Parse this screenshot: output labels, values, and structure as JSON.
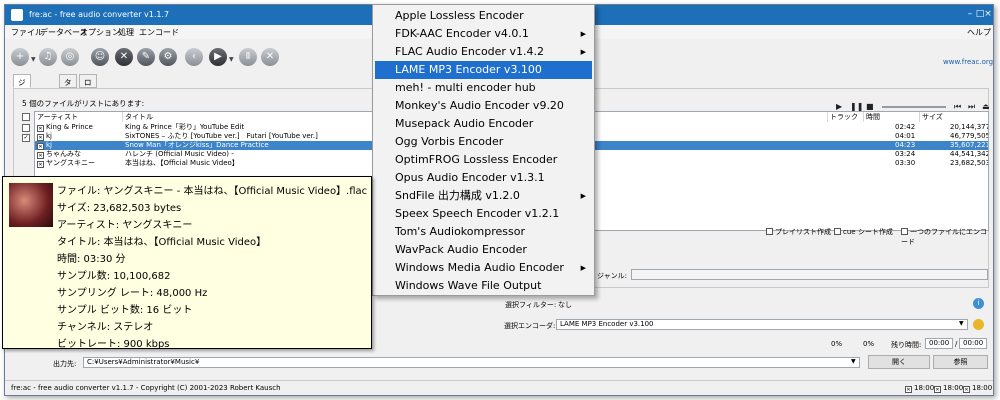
{
  "window": {
    "title": "fre:ac - free audio converter v1.1.7",
    "help": "ヘルプ",
    "website": "www.freac.org"
  },
  "menu": [
    "ファイル",
    "データベース",
    "オプション",
    "処理",
    "エンコード"
  ],
  "tabs": [
    "ジョブリスト",
    "タグ",
    "ログ"
  ],
  "list": {
    "count_text": "5 個のファイルがリストにあります:",
    "headers": [
      "アーティスト",
      "タイトル",
      "トラック",
      "時間",
      "サイズ"
    ],
    "rows": [
      {
        "artist": "King & Prince",
        "title": "King & Prince「彩り」YouTube Edit",
        "time": "02:42",
        "size": "20,144,377"
      },
      {
        "artist": "kj",
        "title": "SixTONES – ふたり [YouTube ver.]　Futari [YouTube ver.]",
        "time": "04:01",
        "size": "46,779,505"
      },
      {
        "artist": "kj",
        "title": "Snow Man「オレンジkiss」Dance Practice",
        "time": "04:23",
        "size": "35,607,221"
      },
      {
        "artist": "ちゃんみな",
        "title": "ハレンチ (Official Music Video) -",
        "time": "03:24",
        "size": "44,541,342"
      },
      {
        "artist": "ヤングスキニー",
        "title": "本当はね、【Official Music Video】",
        "time": "03:30",
        "size": "23,682,503"
      }
    ]
  },
  "options": {
    "playlist": "プレイリスト作成",
    "cue": "cue シート作成",
    "single": "一つのファイルにエンコード",
    "genre_label": "ジャンル:",
    "filter_label": "選択フィルター:",
    "filter_value": "なし",
    "encoder_label": "選択エンコーダ:",
    "encoder_value": "LAME MP3 Encoder v3.100",
    "pct1": "0%",
    "pct2": "0%",
    "remain_label": "残り時間:",
    "remain1": "00:00",
    "remain2": "00:00",
    "output_label": "出力先:",
    "output_path": "C:¥Users¥Administrator¥Music¥",
    "browse": "開く",
    "ref": "参照"
  },
  "status": {
    "text": "fre:ac - free audio converter v1.1.7 - Copyright (C) 2001-2023 Robert Kausch",
    "t1": "18:00",
    "t2": "18:00",
    "t3": "18:00"
  },
  "encoder_menu": [
    {
      "label": "Apple Lossless Encoder",
      "sub": false
    },
    {
      "label": "FDK-AAC Encoder v4.0.1",
      "sub": true
    },
    {
      "label": "FLAC Audio Encoder v1.4.2",
      "sub": true
    },
    {
      "label": "LAME MP3 Encoder v3.100",
      "sub": false,
      "highlight": true
    },
    {
      "label": "meh! - multi encoder hub",
      "sub": false
    },
    {
      "label": "Monkey's Audio Encoder v9.20",
      "sub": false
    },
    {
      "label": "Musepack Audio Encoder",
      "sub": false
    },
    {
      "label": "Ogg Vorbis Encoder",
      "sub": false
    },
    {
      "label": "OptimFROG Lossless Encoder",
      "sub": false
    },
    {
      "label": "Opus Audio Encoder v1.3.1",
      "sub": false
    },
    {
      "label": "SndFile 出力構成 v1.2.0",
      "sub": true
    },
    {
      "label": "Speex Speech Encoder v1.2.1",
      "sub": false
    },
    {
      "label": "Tom's Audiokompressor",
      "sub": false
    },
    {
      "label": "WavPack Audio Encoder",
      "sub": false
    },
    {
      "label": "Windows Media Audio Encoder",
      "sub": true
    },
    {
      "label": "Windows Wave File Output",
      "sub": false
    }
  ],
  "tooltip": [
    "ファイル: ヤングスキニー - 本当はね、【Official Music Video】.flac",
    "サイズ: 23,682,503 bytes",
    "アーティスト: ヤングスキニー",
    "タイトル: 本当はね、【Official Music Video】",
    "時間: 03:30 分",
    "サンプル数: 10,100,682",
    "サンプリング レート: 48,000 Hz",
    "サンプル ビット数: 16 ビット",
    "チャンネル: ステレオ",
    "ビットレート: 900 kbps"
  ]
}
